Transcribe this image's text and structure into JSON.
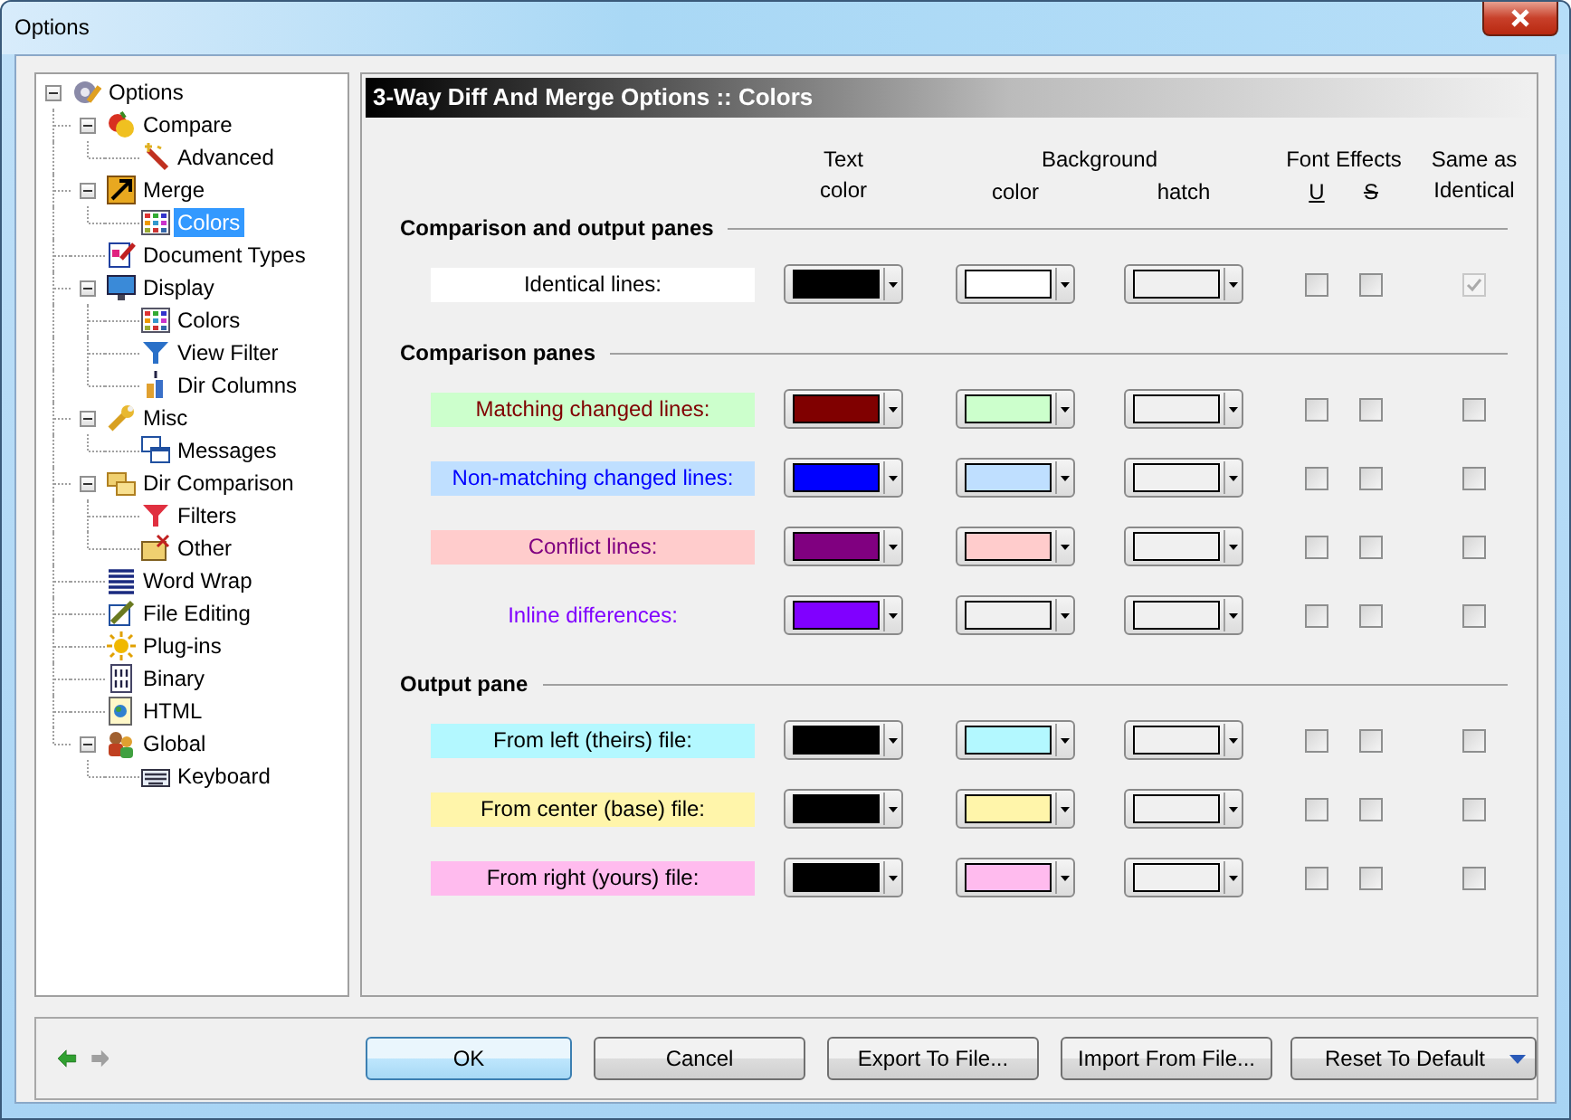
{
  "window": {
    "title": "Options"
  },
  "tree": {
    "label": "Options",
    "expanded": true,
    "selected": false,
    "children": [
      {
        "label": "Compare",
        "expanded": true,
        "selected": false,
        "children": [
          {
            "label": "Advanced",
            "selected": false
          }
        ]
      },
      {
        "label": "Merge",
        "expanded": true,
        "selected": false,
        "children": [
          {
            "label": "Colors",
            "selected": true
          }
        ]
      },
      {
        "label": "Document Types",
        "selected": false
      },
      {
        "label": "Display",
        "expanded": true,
        "selected": false,
        "children": [
          {
            "label": "Colors",
            "selected": false
          },
          {
            "label": "View Filter",
            "selected": false
          },
          {
            "label": "Dir Columns",
            "selected": false
          }
        ]
      },
      {
        "label": "Misc",
        "expanded": true,
        "selected": false,
        "children": [
          {
            "label": "Messages",
            "selected": false
          }
        ]
      },
      {
        "label": "Dir Comparison",
        "expanded": true,
        "selected": false,
        "children": [
          {
            "label": "Filters",
            "selected": false
          },
          {
            "label": "Other",
            "selected": false
          }
        ]
      },
      {
        "label": "Word Wrap",
        "selected": false
      },
      {
        "label": "File Editing",
        "selected": false
      },
      {
        "label": "Plug-ins",
        "selected": false
      },
      {
        "label": "Binary",
        "selected": false
      },
      {
        "label": "HTML",
        "selected": false
      },
      {
        "label": "Global",
        "expanded": true,
        "selected": false,
        "children": [
          {
            "label": "Keyboard",
            "selected": false
          }
        ]
      }
    ]
  },
  "page_header": "3-Way Diff And Merge Options :: Colors",
  "headings": {
    "text_top": "Text",
    "text_bottom": "color",
    "background": "Background",
    "background_color": "color",
    "background_hatch": "hatch",
    "font_effects": "Font Effects",
    "underline": "U",
    "strikeout": "S",
    "same_top": "Same as",
    "same_bottom": "Identical"
  },
  "sections": [
    {
      "title": "Comparison and output panes",
      "rows": [
        {
          "label": "Identical lines:",
          "swatches": [
            {
              "color": "#000000"
            },
            {
              "color": "#ffffff"
            },
            {
              "color": "#f0f0f0"
            }
          ],
          "underline": false,
          "strikeout": false,
          "same_as_identical": {
            "checked": true,
            "disabled": true
          }
        }
      ]
    },
    {
      "title": "Comparison panes",
      "rows": [
        {
          "label": "Matching changed lines:",
          "swatches": [
            {
              "color": "#800000"
            },
            {
              "color": "#ccffcc"
            },
            {
              "color": "#f0f0f0"
            }
          ],
          "underline": false,
          "strikeout": false,
          "same_as_identical": {
            "checked": false,
            "disabled": false
          }
        },
        {
          "label": "Non-matching changed lines:",
          "swatches": [
            {
              "color": "#0000ff"
            },
            {
              "color": "#bfdfff"
            },
            {
              "color": "#f0f0f0"
            }
          ],
          "underline": false,
          "strikeout": false,
          "same_as_identical": {
            "checked": false,
            "disabled": false
          }
        },
        {
          "label": "Conflict lines:",
          "swatches": [
            {
              "color": "#800080"
            },
            {
              "color": "#ffcccc"
            },
            {
              "color": "#f0f0f0"
            }
          ],
          "underline": false,
          "strikeout": false,
          "same_as_identical": {
            "checked": false,
            "disabled": false
          }
        },
        {
          "label": "Inline differences:",
          "swatches": [
            {
              "color": "#8000ff"
            },
            {
              "color": "#f0f0f0"
            },
            {
              "color": "#f0f0f0"
            }
          ],
          "underline": false,
          "strikeout": false,
          "same_as_identical": {
            "checked": false,
            "disabled": false
          }
        }
      ]
    },
    {
      "title": "Output pane",
      "rows": [
        {
          "label": "From left (theirs) file:",
          "swatches": [
            {
              "color": "#000000"
            },
            {
              "color": "#b3f8ff"
            },
            {
              "color": "#f0f0f0"
            }
          ],
          "underline": false,
          "strikeout": false,
          "same_as_identical": {
            "checked": false,
            "disabled": false
          }
        },
        {
          "label": "From center (base) file:",
          "swatches": [
            {
              "color": "#000000"
            },
            {
              "color": "#fff5aa"
            },
            {
              "color": "#f0f0f0"
            }
          ],
          "underline": false,
          "strikeout": false,
          "same_as_identical": {
            "checked": false,
            "disabled": false
          }
        },
        {
          "label": "From right (yours) file:",
          "swatches": [
            {
              "color": "#000000"
            },
            {
              "color": "#ffbbee"
            },
            {
              "color": "#f0f0f0"
            }
          ],
          "underline": false,
          "strikeout": false,
          "same_as_identical": {
            "checked": false,
            "disabled": false
          }
        }
      ]
    }
  ],
  "nav": {
    "back": {
      "disabled": false
    },
    "forward": {
      "disabled": true
    }
  },
  "buttons": [
    {
      "label": "OK",
      "kind": "default"
    },
    {
      "label": "Cancel",
      "kind": "plain"
    },
    {
      "label": "Export To File...",
      "kind": "plain"
    },
    {
      "label": "Import From File...",
      "kind": "plain"
    },
    {
      "label": "Reset To Default",
      "kind": "split"
    }
  ]
}
